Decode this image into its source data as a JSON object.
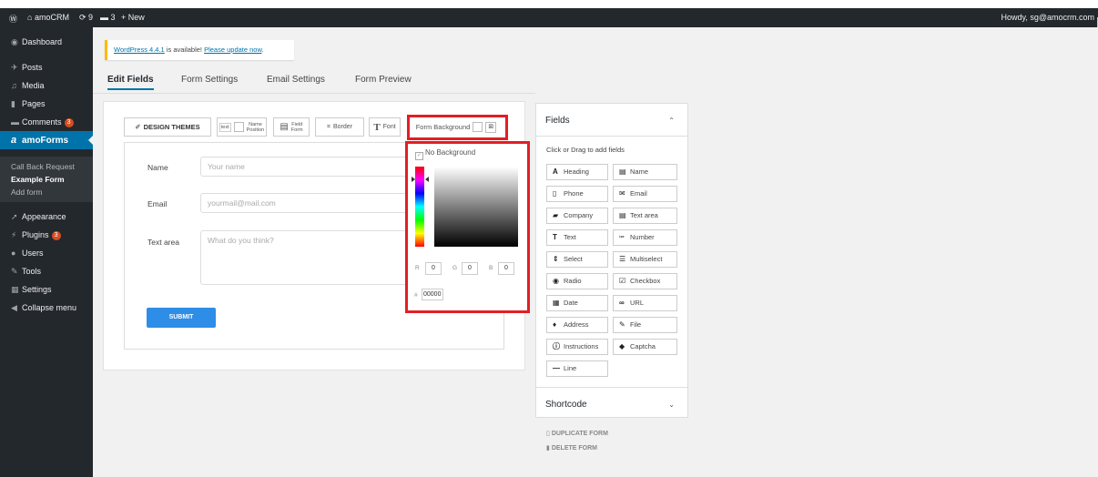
{
  "admin_bar": {
    "wp_logo": "wordpress-logo",
    "site_name": "amoCRM",
    "updates_count": "9",
    "comments_count": "3",
    "new_label": "New",
    "howdy": "Howdy, sg@amocrm.com"
  },
  "menu": [
    {
      "label": "Dashboard",
      "icon": "dashboard-icon",
      "glyph": "◉"
    },
    {
      "label": "Posts",
      "icon": "pin-icon",
      "glyph": "✈"
    },
    {
      "label": "Media",
      "icon": "media-icon",
      "glyph": "♫"
    },
    {
      "label": "Pages",
      "icon": "pages-icon",
      "glyph": "▮"
    },
    {
      "label": "Comments",
      "icon": "comment-icon",
      "glyph": "▬",
      "badge": "3"
    },
    {
      "label": "amoForms",
      "icon": "amo-logo-icon",
      "glyph": "a"
    },
    {
      "label": "Appearance",
      "icon": "brush-icon",
      "glyph": "➚"
    },
    {
      "label": "Plugins",
      "icon": "plugin-icon",
      "glyph": "⚡",
      "badge": "3"
    },
    {
      "label": "Users",
      "icon": "user-icon",
      "glyph": "●"
    },
    {
      "label": "Tools",
      "icon": "wrench-icon",
      "glyph": "✎"
    },
    {
      "label": "Settings",
      "icon": "settings-icon",
      "glyph": "▦"
    },
    {
      "label": "Collapse menu",
      "icon": "collapse-icon",
      "glyph": "◀"
    }
  ],
  "submenu": [
    {
      "label": "Call Back Request"
    },
    {
      "label": "Example Form",
      "current": true
    },
    {
      "label": "Add form"
    }
  ],
  "notice": {
    "version_text": "WordPress 4.4.1",
    "middle": " is available! ",
    "link": "Please update now",
    "end": "."
  },
  "tabs": [
    "Edit Fields",
    "Form Settings",
    "Email Settings",
    "Form Preview"
  ],
  "toolbar": {
    "design_themes": "DESIGN THEMES",
    "text_tag": "text",
    "name_position_1": "Name",
    "name_position_2": "Position",
    "field_form_1": "Field",
    "field_form_2": "Form",
    "border": "Border",
    "font": "Font",
    "form_background": "Form Background"
  },
  "form": {
    "fields": [
      {
        "label": "Name",
        "placeholder": "Your name"
      },
      {
        "label": "Email",
        "placeholder": "yourmail@mail.com"
      },
      {
        "label": "Text area",
        "placeholder": "What do you think?"
      }
    ],
    "submit": "SUBMIT"
  },
  "picker": {
    "no_background": "No Background",
    "r_label": "R",
    "g_label": "G",
    "b_label": "B",
    "r": "0",
    "g": "0",
    "b": "0",
    "hash": "#",
    "hex": "00000"
  },
  "fields_panel": {
    "title": "Fields",
    "hint": "Click or Drag to add fields",
    "items": [
      {
        "label": "Heading",
        "icon": "heading-icon",
        "glyph": "A"
      },
      {
        "label": "Name",
        "icon": "name-card-icon",
        "glyph": "▤"
      },
      {
        "label": "Phone",
        "icon": "phone-icon",
        "glyph": "▯"
      },
      {
        "label": "Email",
        "icon": "envelope-icon",
        "glyph": "✉"
      },
      {
        "label": "Company",
        "icon": "briefcase-icon",
        "glyph": "▰"
      },
      {
        "label": "Text area",
        "icon": "textarea-icon",
        "glyph": "▤"
      },
      {
        "label": "Text",
        "icon": "text-icon",
        "glyph": "T"
      },
      {
        "label": "Number",
        "icon": "number-icon",
        "glyph": "¹²³"
      },
      {
        "label": "Select",
        "icon": "select-icon",
        "glyph": "⇕"
      },
      {
        "label": "Multiselect",
        "icon": "multiselect-icon",
        "glyph": "☰"
      },
      {
        "label": "Radio",
        "icon": "radio-icon",
        "glyph": "◉"
      },
      {
        "label": "Checkbox",
        "icon": "checkbox-icon",
        "glyph": "☑"
      },
      {
        "label": "Date",
        "icon": "calendar-icon",
        "glyph": "▦"
      },
      {
        "label": "URL",
        "icon": "link-icon",
        "glyph": "∞"
      },
      {
        "label": "Address",
        "icon": "map-marker-icon",
        "glyph": "♦"
      },
      {
        "label": "File",
        "icon": "paperclip-icon",
        "glyph": "✎"
      },
      {
        "label": "Instructions",
        "icon": "info-icon",
        "glyph": "ⓘ"
      },
      {
        "label": "Captcha",
        "icon": "captcha-icon",
        "glyph": "◆"
      },
      {
        "label": "Line",
        "icon": "line-icon",
        "glyph": "—"
      }
    ],
    "shortcode": "Shortcode"
  },
  "actions": {
    "duplicate": "DUPLICATE FORM",
    "delete": "DELETE FORM"
  },
  "colors": {
    "accent": "#0073aa",
    "highlight": "#e31e24",
    "submit": "#2e8de6"
  }
}
